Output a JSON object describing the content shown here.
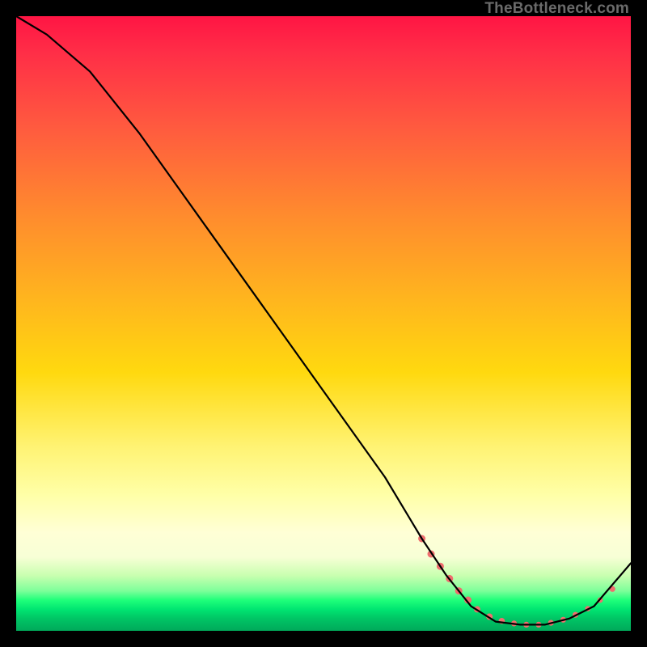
{
  "credit": "TheBottleneck.com",
  "chart_data": {
    "type": "line",
    "title": "",
    "xlabel": "",
    "ylabel": "",
    "xlim": [
      0,
      100
    ],
    "ylim": [
      0,
      100
    ],
    "series": [
      {
        "name": "curve",
        "x": [
          0,
          5,
          12,
          20,
          30,
          40,
          50,
          60,
          66,
          70,
          74,
          78,
          82,
          86,
          90,
          94,
          100
        ],
        "y": [
          100,
          97,
          91,
          81,
          67,
          53,
          39,
          25,
          15,
          9,
          4,
          1.5,
          1,
          1,
          2,
          4,
          11
        ]
      }
    ],
    "markers": {
      "name": "highlight-points",
      "color": "#ef6e6e",
      "points": [
        {
          "x": 66,
          "y": 15,
          "r": 4.5
        },
        {
          "x": 67.5,
          "y": 12.5,
          "r": 4.5
        },
        {
          "x": 69,
          "y": 10.5,
          "r": 4.5
        },
        {
          "x": 70.5,
          "y": 8.5,
          "r": 4.5
        },
        {
          "x": 72,
          "y": 6.5,
          "r": 4.5
        },
        {
          "x": 73.5,
          "y": 5,
          "r": 4.5
        },
        {
          "x": 75,
          "y": 3.5,
          "r": 4
        },
        {
          "x": 77,
          "y": 2.3,
          "r": 4
        },
        {
          "x": 79,
          "y": 1.6,
          "r": 3.8
        },
        {
          "x": 81,
          "y": 1.2,
          "r": 3.6
        },
        {
          "x": 83,
          "y": 1.0,
          "r": 3.6
        },
        {
          "x": 85,
          "y": 1.0,
          "r": 3.6
        },
        {
          "x": 87,
          "y": 1.3,
          "r": 3.6
        },
        {
          "x": 89,
          "y": 1.8,
          "r": 3.6
        },
        {
          "x": 91,
          "y": 2.6,
          "r": 3.6
        },
        {
          "x": 93,
          "y": 3.6,
          "r": 3.4
        },
        {
          "x": 95,
          "y": 5.0,
          "r": 3.4
        },
        {
          "x": 97,
          "y": 6.8,
          "r": 3.6
        }
      ]
    }
  }
}
